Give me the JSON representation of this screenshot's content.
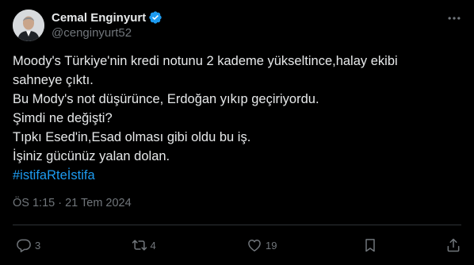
{
  "author": {
    "display_name": "Cemal Enginyurt",
    "handle": "@cenginyurt52",
    "verified": true
  },
  "tweet": {
    "lines": [
      "Moody's Türkiye'nin kredi notunu 2 kademe yükseltince,halay ekibi",
      "sahneye çıktı.",
      "Bu Mody's not düşürünce, Erdoğan yıkıp geçiriyordu.",
      "Şimdi ne değişti?",
      "Tıpkı Esed'in,Esad olması gibi oldu bu iş.",
      "İşiniz gücünüz yalan dolan."
    ],
    "hashtag": "#istifaRteİstifa",
    "time": "ÖS 1:15",
    "separator": "·",
    "date": "21 Tem 2024"
  },
  "actions": {
    "replies": "3",
    "retweets": "4",
    "likes": "19"
  },
  "icons": {
    "more": "more-horizontal-icon",
    "verified": "verified-badge-icon",
    "reply": "reply-icon",
    "retweet": "retweet-icon",
    "like": "heart-icon",
    "bookmark": "bookmark-icon",
    "share": "share-icon"
  },
  "colors": {
    "background": "#000000",
    "text": "#e7e9ea",
    "secondary": "#71767b",
    "accent": "#1d9bf0",
    "divider": "#2f3336"
  }
}
